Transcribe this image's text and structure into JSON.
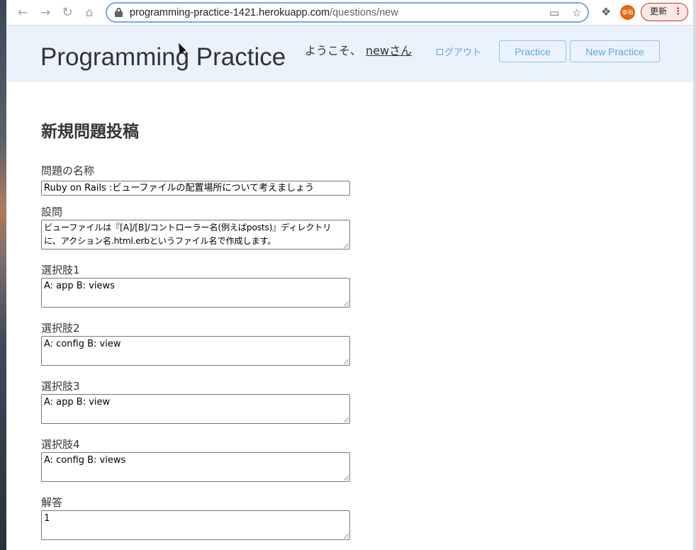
{
  "browser": {
    "url_host": "programming-practice-1421.herokuapp.com",
    "url_path": "/questions/new",
    "profile_label": "泰裕",
    "update_label": "更新"
  },
  "header": {
    "site_title": "Programming Practice",
    "welcome_prefix": "ようこそ、",
    "user_name": "newさん",
    "logout_label": "ログアウト",
    "practice_button": "Practice",
    "new_practice_button": "New Practice"
  },
  "form": {
    "title": "新規問題投稿",
    "name_label": "問題の名称",
    "name_value": "Ruby on Rails :ビューファイルの配置場所について考えましょう",
    "question_label": "設問",
    "question_value": "ビューファイルは『[A]/[B]/コントローラー名(例えばposts)』ディレクトリに、アクション名.html.erbというファイル名で作成します。",
    "choice1_label": "選択肢1",
    "choice1_value": "A: app B: views",
    "choice2_label": "選択肢2",
    "choice2_value": "A: config B: view",
    "choice3_label": "選択肢3",
    "choice3_value": "A: app B: view",
    "choice4_label": "選択肢4",
    "choice4_value": "A: config B: views",
    "answer_label": "解答",
    "answer_value": "1"
  },
  "icons": {
    "back": "arrow-left",
    "forward": "arrow-right",
    "reload": "reload",
    "home": "home",
    "lock": "lock",
    "cast": "devices",
    "bookmark": "star",
    "extensions": "puzzle",
    "menu": "vertical-dots"
  },
  "colors": {
    "header_bg": "#eaf3fc",
    "accent": "#5fa6e0",
    "update_border": "#c9302c",
    "profile_bg": "#e8650c"
  }
}
